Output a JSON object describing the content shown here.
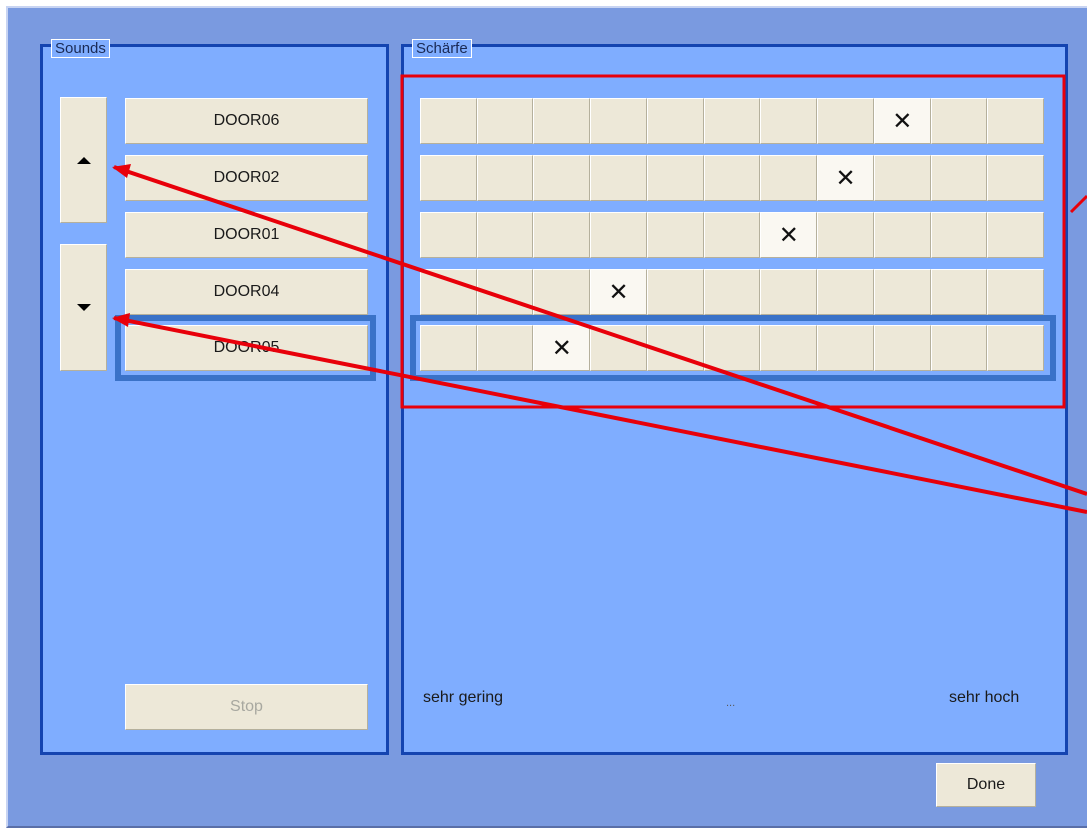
{
  "sounds_panel": {
    "title": "Sounds",
    "items": [
      {
        "label": "DOOR06"
      },
      {
        "label": "DOOR02"
      },
      {
        "label": "DOOR01"
      },
      {
        "label": "DOOR04"
      },
      {
        "label": "DOOR05"
      }
    ],
    "selected_index": 4,
    "move_up_icon": "triangle-up-icon",
    "move_down_icon": "triangle-down-icon",
    "stop_label": "Stop",
    "stop_enabled": false
  },
  "rating_panel": {
    "title": "Schärfe",
    "columns": 11,
    "mark_symbol": "✕",
    "ratings": [
      {
        "sound": "DOOR06",
        "marked_column": 9
      },
      {
        "sound": "DOOR02",
        "marked_column": 8
      },
      {
        "sound": "DOOR01",
        "marked_column": 7
      },
      {
        "sound": "DOOR04",
        "marked_column": 4
      },
      {
        "sound": "DOOR05",
        "marked_column": 3
      }
    ],
    "scale_min_label": "sehr gering",
    "scale_mid_label": "...",
    "scale_max_label": "sehr hoch"
  },
  "done_label": "Done",
  "colors": {
    "window_bg": "#7a9ae0",
    "panel_bg": "#7fadff",
    "panel_border": "#1444b0",
    "selection_frame": "#3a72c8",
    "button_face": "#ede8d8",
    "annotation": "#e8000a"
  }
}
